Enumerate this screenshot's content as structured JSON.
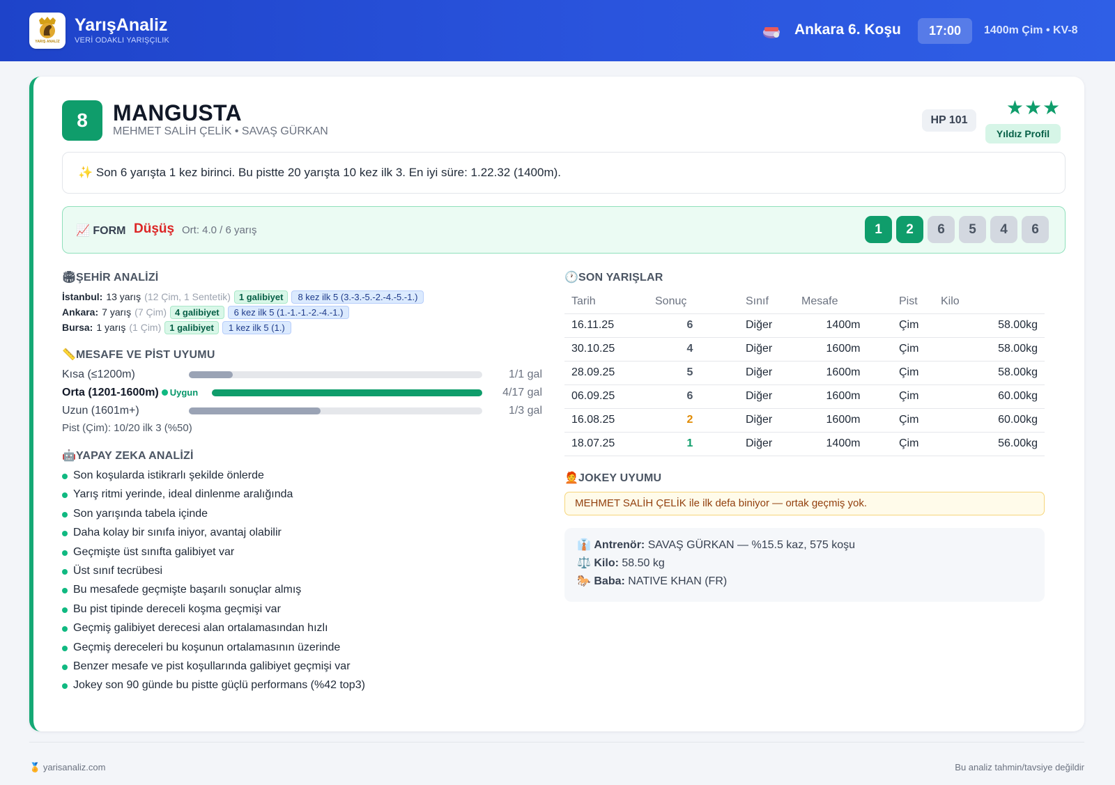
{
  "header": {
    "brand_name": "YarışAnaliz",
    "brand_tagline": "VERİ ODAKLI YARIŞÇILIK",
    "logo_text": "YARIŞ ANALİZ",
    "race_title": "Ankara 6. Koşu",
    "race_time": "17:00",
    "race_meta": "1400m Çim • KV-8"
  },
  "horse": {
    "number": "8",
    "name": "MANGUSTA",
    "connections": "MEHMET SALİH ÇELİK • SAVAŞ GÜRKAN",
    "hp": "HP 101",
    "stars": "★★★",
    "star_rating": 3,
    "profile_label": "Yıldız Profil",
    "summary": "✨ Son 6 yarışta 1 kez birinci. Bu pistte 20 yarışta 10 kez ilk 3. En iyi süre: 1.22.32 (1400m)."
  },
  "form": {
    "label": "📈 FORM",
    "trend": "Düşüş",
    "avg": "Ort: 4.0 / 6 yarış",
    "results": [
      "1",
      "2",
      "6",
      "5",
      "4",
      "6"
    ]
  },
  "city": {
    "title": "ŞEHİR ANALİZİ",
    "rows": [
      {
        "name": "İstanbul:",
        "races": "13 yarış",
        "detail": "(12 Çim, 1 Sentetik)",
        "wins": "1 galibiyet",
        "top5": "8 kez ilk 5 (3.-3.-5.-2.-4.-5.-1.)"
      },
      {
        "name": "Ankara:",
        "races": "7 yarış",
        "detail": "(7 Çim)",
        "wins": "4 galibiyet",
        "top5": "6 kez ilk 5 (1.-1.-1.-2.-4.-1.)"
      },
      {
        "name": "Bursa:",
        "races": "1 yarış",
        "detail": "(1 Çim)",
        "wins": "1 galibiyet",
        "top5": "1 kez ilk 5 (1.)"
      }
    ]
  },
  "distance": {
    "title": "MESAFE VE PİST UYUMU",
    "ok_label": "Uygun",
    "rows": [
      {
        "label": "Kısa (≤1200m)",
        "value": "1/1 gal",
        "ratio": 0.15
      },
      {
        "label": "Orta (1201-1600m)",
        "value": "4/17 gal",
        "ratio": 1.0
      },
      {
        "label": "Uzun (1601m+)",
        "value": "1/3 gal",
        "ratio": 0.45
      }
    ],
    "pist_note": "Pist (Çim): 10/20 ilk 3 (%50)"
  },
  "ai": {
    "title": "YAPAY ZEKA ANALİZİ",
    "items": [
      "Son koşularda istikrarlı şekilde önlerde",
      "Yarış ritmi yerinde, ideal dinlenme aralığında",
      "Son yarışında tabela içinde",
      "Daha kolay bir sınıfa iniyor, avantaj olabilir",
      "Geçmişte üst sınıfta galibiyet var",
      "Üst sınıf tecrübesi",
      "Bu mesafede geçmişte başarılı sonuçlar almış",
      "Bu pist tipinde dereceli koşma geçmişi var",
      "Geçmiş galibiyet derecesi alan ortalamasından hızlı",
      "Geçmiş dereceleri bu koşunun ortalamasının üzerinde",
      "Benzer mesafe ve pist koşullarında galibiyet geçmişi var",
      "Jokey son 90 günde bu pistte güçlü performans (%42 top3)"
    ]
  },
  "races": {
    "title": "SON YARIŞLAR",
    "headers": [
      "Tarih",
      "Sonuç",
      "Sınıf",
      "Mesafe",
      "Pist",
      "Kilo"
    ],
    "rows": [
      {
        "date": "16.11.25",
        "result": "6",
        "class": "Diğer",
        "dist": "1400m",
        "pist": "Çim",
        "kilo": "58.00kg",
        "color": "#4b5563"
      },
      {
        "date": "30.10.25",
        "result": "4",
        "class": "Diğer",
        "dist": "1600m",
        "pist": "Çim",
        "kilo": "58.00kg",
        "color": "#4b5563"
      },
      {
        "date": "28.09.25",
        "result": "5",
        "class": "Diğer",
        "dist": "1600m",
        "pist": "Çim",
        "kilo": "58.00kg",
        "color": "#4b5563"
      },
      {
        "date": "06.09.25",
        "result": "6",
        "class": "Diğer",
        "dist": "1600m",
        "pist": "Çim",
        "kilo": "60.00kg",
        "color": "#4b5563"
      },
      {
        "date": "16.08.25",
        "result": "2",
        "class": "Diğer",
        "dist": "1600m",
        "pist": "Çim",
        "kilo": "60.00kg",
        "color": "#e08a00"
      },
      {
        "date": "18.07.25",
        "result": "1",
        "class": "Diğer",
        "dist": "1400m",
        "pist": "Çim",
        "kilo": "56.00kg",
        "color": "#0f9d6b"
      }
    ]
  },
  "jockey": {
    "title": "JOKEY UYUMU",
    "note": "MEHMET SALİH ÇELİK ile ilk defa biniyor — ortak geçmiş yok."
  },
  "info": {
    "trainer_label": "Antrenör:",
    "trainer_value": "SAVAŞ GÜRKAN — %15.5 kaz, 575 koşu",
    "kilo_label": "Kilo:",
    "kilo_value": "58.50 kg",
    "sire_label": "Baba:",
    "sire_value": "NATIVE KHAN (FR)"
  },
  "footer": {
    "site": "yarisanaliz.com",
    "disclaimer": "Bu analiz tahmin/tavsiye değildir"
  },
  "colors": {
    "accent": "#0f9d6b",
    "header": "#2a54dd",
    "decline": "#dc2626"
  }
}
